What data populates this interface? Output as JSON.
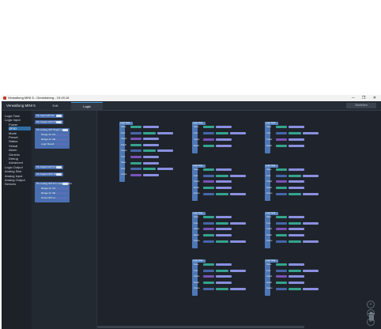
{
  "window": {
    "title": "Verwaltung MINI 5 - Geroldsberg - 19.49.16",
    "controls": "─  ❐  ✕"
  },
  "header": {
    "device_name": "Verwaltung MINI 5",
    "tabs": [
      "Edit",
      "Logic"
    ],
    "active_tab": "Logic",
    "close_label": "Schließen"
  },
  "sidebar": {
    "items": [
      {
        "label": "Logic Task",
        "indent": 1
      },
      {
        "label": "Logic Input",
        "indent": 1
      },
      {
        "label": "Power",
        "indent": 2
      },
      {
        "label": "GPIO",
        "indent": 2,
        "active": true
      },
      {
        "label": "Mode",
        "indent": 2
      },
      {
        "label": "Preset",
        "indent": 2
      },
      {
        "label": "Status",
        "indent": 2
      },
      {
        "label": "Virtual",
        "indent": 2
      },
      {
        "label": "Alarm",
        "indent": 2
      },
      {
        "label": "Generic",
        "indent": 2
      },
      {
        "label": "Debug",
        "indent": 2
      },
      {
        "label": "Advanced",
        "indent": 2
      },
      {
        "label": "Logic Output",
        "indent": 1
      },
      {
        "label": "Analog Sink",
        "indent": 1
      },
      {
        "label": "Analog Input",
        "indent": 1
      },
      {
        "label": "Analog Output",
        "indent": 1
      },
      {
        "label": "Devices",
        "indent": 1
      }
    ]
  },
  "palette": {
    "blocks": [
      {
        "label": "Pin Input GPI Pin",
        "rows": []
      },
      {
        "label": "Pin Output GPO Pin",
        "rows": []
      },
      {
        "label": "Pin Analog GPI Single input",
        "rows": [
          "Range for Active",
          "Range for Idle",
          "Logic Result"
        ]
      },
      {
        "label": "Pin Digital GPI Pin",
        "rows": []
      },
      {
        "label": "Pin Digital GPO Pin",
        "rows": []
      },
      {
        "label": "Pin Analog GPI Pin measurement",
        "rows": [
          "Range for Active",
          "Range for Idle",
          "Cross GPI use"
        ]
      }
    ]
  },
  "canvas": {
    "group_title": "Logic Task",
    "row_labels": [
      "Name",
      "Input",
      "Output",
      "Result",
      "Source",
      "Cmd"
    ],
    "zoom_controls": [
      "+",
      "=",
      "−"
    ],
    "trash_icon": "trash-icon"
  },
  "colors": {
    "accent": "#2e6da4",
    "block_blue": "#4d77b5",
    "block_teal": "#35a38e",
    "block_lavender": "#8a8fe0",
    "block_purple": "#7a52b8"
  }
}
